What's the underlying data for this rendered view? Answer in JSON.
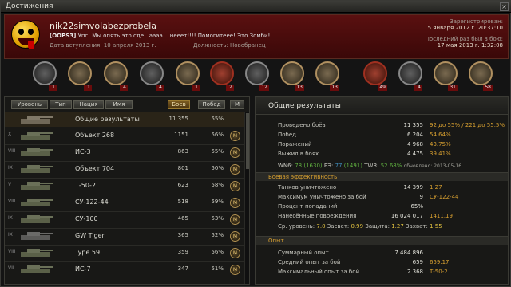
{
  "window": {
    "title": "Достижения"
  },
  "header": {
    "nickname": "nik22simvolabezprobela",
    "clan_tag": "[OOPS3]",
    "motto": "Упс! Мы опять это сде...аааа....нееет!!!! Помогитеее! Это Зомби!",
    "joined": "Дата вступления: 10 апреля 2013 г.",
    "role": "Должность: Новобранец",
    "registered_label": "Зарегистрирован:",
    "registered_value": "5 января 2012 г. 20:37:10",
    "last_battle_label": "Последний раз был в бою:",
    "last_battle_value": "17 мая 2013 г. 1:32:08"
  },
  "medals": [
    {
      "icon": "medal-icon",
      "count": "1"
    },
    {
      "icon": "medal-icon",
      "count": "1"
    },
    {
      "icon": "medal-icon",
      "count": "4"
    },
    {
      "icon": "medal-icon",
      "count": "4"
    },
    {
      "icon": "medal-icon",
      "count": "1"
    },
    {
      "icon": "medal-icon",
      "count": "2"
    },
    {
      "icon": "medal-icon",
      "count": "12"
    },
    {
      "icon": "medal-icon",
      "count": "13"
    },
    {
      "icon": "medal-icon",
      "count": "13"
    },
    {
      "icon": "medal-icon",
      "count": "1"
    },
    {
      "icon": "medal-icon",
      "count": "49"
    },
    {
      "icon": "medal-icon",
      "count": "4"
    },
    {
      "icon": "medal-icon",
      "count": "31"
    },
    {
      "icon": "medal-icon",
      "count": "58"
    }
  ],
  "filters": {
    "tier": "Уровень",
    "type": "Тип",
    "nation": "Нация",
    "name": "Имя",
    "battles": "Боев",
    "wins": "Побед",
    "mastery": "М"
  },
  "vehicles": [
    {
      "tier": "",
      "name": "Общие результаты",
      "battles": "11 355",
      "win": "55%",
      "mastery": ""
    },
    {
      "tier": "X",
      "name": "Объект 268",
      "battles": "1151",
      "win": "56%",
      "mastery": "M"
    },
    {
      "tier": "VIII",
      "name": "ИС-3",
      "battles": "863",
      "win": "55%",
      "mastery": "M"
    },
    {
      "tier": "IX",
      "name": "Объект 704",
      "battles": "801",
      "win": "50%",
      "mastery": "M"
    },
    {
      "tier": "V",
      "name": "Т-50-2",
      "battles": "623",
      "win": "58%",
      "mastery": "M"
    },
    {
      "tier": "VIII",
      "name": "СУ-122-44",
      "battles": "518",
      "win": "59%",
      "mastery": "M"
    },
    {
      "tier": "IX",
      "name": "СУ-100",
      "battles": "465",
      "win": "53%",
      "mastery": "M"
    },
    {
      "tier": "IX",
      "name": "GW Tiger",
      "battles": "365",
      "win": "52%",
      "mastery": "M"
    },
    {
      "tier": "VIII",
      "name": "Type 59",
      "battles": "359",
      "win": "56%",
      "mastery": "M"
    },
    {
      "tier": "VII",
      "name": "ИС-7",
      "battles": "347",
      "win": "51%",
      "mastery": "M"
    }
  ],
  "results": {
    "title": "Общие результаты",
    "rows": [
      {
        "label": "Проведено боёв",
        "value": "11 355",
        "extra": "92 до 55% / 221 до 55.5%"
      },
      {
        "label": "Побед",
        "value": "6 204",
        "extra": "54.64%"
      },
      {
        "label": "Поражений",
        "value": "4 968",
        "extra": "43.75%"
      },
      {
        "label": "Выжил в боях",
        "value": "4 475",
        "extra": "39.41%"
      }
    ],
    "wn6_label": "WN6:",
    "wn6": "78",
    "wn6_b": "(1630)",
    "r3_label": "РЭ:",
    "r3": "77",
    "r3_b": "(1491)",
    "twr_label": "TWR:",
    "twr": "52.68%",
    "updated": "обновлено: 2013-05-16",
    "eff_title": "Боевая эффективность",
    "eff_rows": [
      {
        "label": "Танков уничтожено",
        "value": "14 399",
        "extra": "1.27"
      },
      {
        "label": "Максимум уничтожено за бой",
        "value": "9",
        "extra": "СУ-122-44"
      },
      {
        "label": "Процент попаданий",
        "value": "65%",
        "extra": ""
      },
      {
        "label": "Нанесённые повреждения",
        "value": "16 024 017",
        "extra": "1411.19"
      }
    ],
    "avg_level_label": "Ср. уровень:",
    "avg_level": "7.0",
    "spot_label": "Засвет:",
    "spot": "0.99",
    "defense_label": "Защита:",
    "defense": "1.27",
    "capture_label": "Захват:",
    "capture": "1.55",
    "exp_title": "Опыт",
    "exp_rows": [
      {
        "label": "Суммарный опыт",
        "value": "7 484 896",
        "extra": ""
      },
      {
        "label": "Средний опыт за бой",
        "value": "659",
        "extra": "659.17"
      },
      {
        "label": "Максимальный опыт за бой",
        "value": "2 368",
        "extra": "Т-50-2"
      }
    ]
  }
}
